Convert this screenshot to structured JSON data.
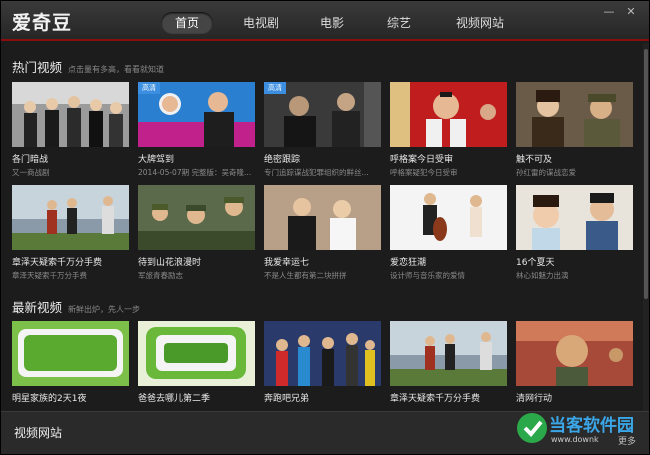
{
  "app": {
    "logo": "爱奇豆",
    "nav": [
      {
        "label": "首页",
        "active": true
      },
      {
        "label": "电视剧",
        "active": false
      },
      {
        "label": "电影",
        "active": false
      },
      {
        "label": "综艺",
        "active": false
      },
      {
        "label": "视频网站",
        "active": false
      }
    ],
    "minimize_glyph": "—",
    "close_glyph": "✕"
  },
  "hot": {
    "title": "热门视频",
    "subtitle": "点击量有多高，看看就知道",
    "items": [
      {
        "title": "各门暗战",
        "sub": "又一商战剧",
        "badge": ""
      },
      {
        "title": "大牌驾到",
        "sub": "2014-05-07期 完整版：吴奇隆...",
        "badge": "高清"
      },
      {
        "title": "绝密跟踪",
        "sub": "专门追踪谍战犯罪组织的鲜丝...",
        "badge": "高清"
      },
      {
        "title": "呼格案今日受审",
        "sub": "呼格案疑犯今日受审",
        "badge": ""
      },
      {
        "title": "触不可及",
        "sub": "孙红雷的谍战恋爱",
        "badge": ""
      },
      {
        "title": "章泽天疑索千万分手费",
        "sub": "章泽天疑索千万分手费",
        "badge": ""
      },
      {
        "title": "待到山花浪漫时",
        "sub": "军旅青春励志",
        "badge": ""
      },
      {
        "title": "我爱幸运七",
        "sub": "不是人生都有第二块拼拼",
        "badge": ""
      },
      {
        "title": "爱恋狂潮",
        "sub": "设计师与音乐家的爱情",
        "badge": ""
      },
      {
        "title": "16个夏天",
        "sub": "林心如魅力出演",
        "badge": ""
      }
    ]
  },
  "latest": {
    "title": "最新视频",
    "subtitle": "新鲜出炉，先人一步",
    "items": [
      {
        "title": "明星家族的2天1夜",
        "sub": ""
      },
      {
        "title": "爸爸去哪儿第二季",
        "sub": ""
      },
      {
        "title": "奔跑吧兄弟",
        "sub": ""
      },
      {
        "title": "章泽天疑索千万分手费",
        "sub": ""
      },
      {
        "title": "清网行动",
        "sub": ""
      }
    ]
  },
  "bottom": {
    "label": "视频网站",
    "more": "更多"
  },
  "watermark": {
    "text": "当客软件园",
    "url": "www.downk"
  }
}
